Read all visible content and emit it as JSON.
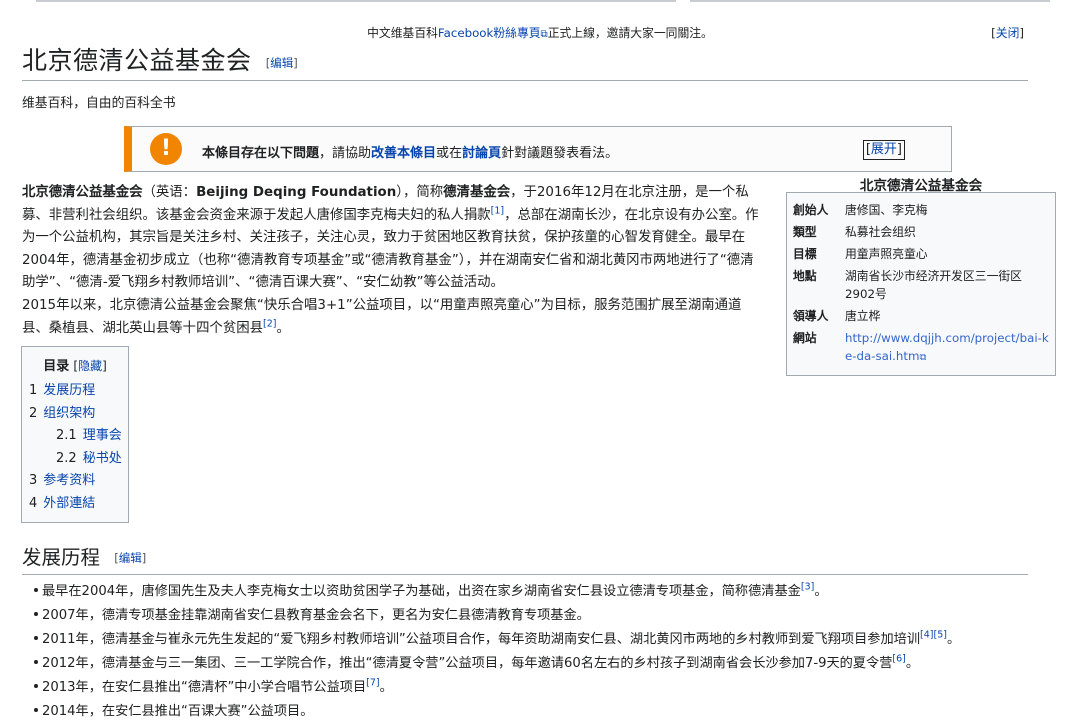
{
  "sitenotice": {
    "prefix": "中文维基百科",
    "link": "Facebook粉絲專頁",
    "suffix": "正式上線，邀請大家一同關注。",
    "close_label": "关闭"
  },
  "page": {
    "title": "北京德清公益基金会",
    "edit_label": "编辑",
    "tagline": "维基百科，自由的百科全书"
  },
  "ambox": {
    "icon": "exclamation-icon",
    "lead_bold": "本條目存在以下問題",
    "text1": "，請協助",
    "link1": "改善本條目",
    "text2": "或在",
    "link2": "討論頁",
    "text3": "針對議題發表看法。",
    "expand_label": "展开"
  },
  "lead": {
    "p1_bold": "北京德清公益基金会",
    "p1_a": "（英语：",
    "p1_en": "Beijing Deqing Foundation",
    "p1_b": "），简称",
    "p1_short": "德清基金会",
    "p1_c": "，于2016年12月在北京注册，是一个私募、非营利社会组织。该基金会资金来源于发起人唐修国李克梅夫妇的私人捐款",
    "ref1": "[1]",
    "p1_d": "，总部在湖南长沙，在北京设有办公室。作为一个公益机构，其宗旨是关注乡村、关注孩子，关注心灵，致力于贫困地区教育扶贫，保护孩童的心智发育健全。最早在2004年，德清基金初步成立（也称“德清教育专项基金”或“德清教育基金”），并在湖南安仁省和湖北黄冈市两地进行了“德清助学”、“德清-爱飞翔乡村教师培训”、“德清百课大赛”、“安仁幼教”等公益活动。",
    "p2": "2015年以来，北京德清公益基金会聚焦“快乐合唱3+1”公益项目，以“用童声照亮童心”为目标，服务范围扩展至湖南通道县、桑植县、湖北英山县等十四个贫困县",
    "ref2": "[2]",
    "p2_end": "。"
  },
  "infobox": {
    "title": "北京德清公益基金会",
    "rows": [
      {
        "label": "創始人",
        "value": "唐修国、李克梅"
      },
      {
        "label": "類型",
        "value": "私募社会组织"
      },
      {
        "label": "目標",
        "value": "用童声照亮童心"
      },
      {
        "label": "地點",
        "value": "湖南省长沙市经济开发区三一街区2902号"
      },
      {
        "label": "領導人",
        "value": "唐立桦"
      },
      {
        "label": "網站",
        "value": "http://www.dqjjh.com/project/bai-ke-da-sai.htm"
      }
    ]
  },
  "toc": {
    "title": "目录",
    "hide_label": "隐藏",
    "items": [
      {
        "num": "1",
        "label": "发展历程"
      },
      {
        "num": "2",
        "label": "组织架构"
      },
      {
        "num": "2.1",
        "label": "理事会"
      },
      {
        "num": "2.2",
        "label": "秘书处"
      },
      {
        "num": "3",
        "label": "参考资料"
      },
      {
        "num": "4",
        "label": "外部連結"
      }
    ]
  },
  "section": {
    "title": "发展历程",
    "edit_label": "编辑",
    "events": [
      {
        "text": "最早在2004年，唐修国先生及夫人李克梅女士以资助贫困学子为基础，出资在家乡湖南省安仁县设立德清专项基金，简称德清基金",
        "ref": "[3]",
        "end": "。"
      },
      {
        "text": "2007年，德清专项基金挂靠湖南省安仁县教育基金会名下，更名为安仁县德清教育专项基金。",
        "ref": "",
        "end": ""
      },
      {
        "text": "2011年，德清基金与崔永元先生发起的“爱飞翔乡村教师培训”公益项目合作，每年资助湖南安仁县、湖北黄冈市两地的乡村教师到爱飞翔项目参加培训",
        "ref": "[4][5]",
        "end": "。"
      },
      {
        "text": "2012年，德清基金与三一集团、三一工学院合作，推出“德清夏令营”公益项目，每年邀请60名左右的乡村孩子到湖南省会长沙参加7-9天的夏令营",
        "ref": "[6]",
        "end": "。"
      },
      {
        "text": "2013年，在安仁县推出“德清杯”中小学合唱节公益项目",
        "ref": "[7]",
        "end": "。"
      },
      {
        "text": "2014年，在安仁县推出“百课大赛”公益项目。",
        "ref": "",
        "end": ""
      }
    ]
  }
}
